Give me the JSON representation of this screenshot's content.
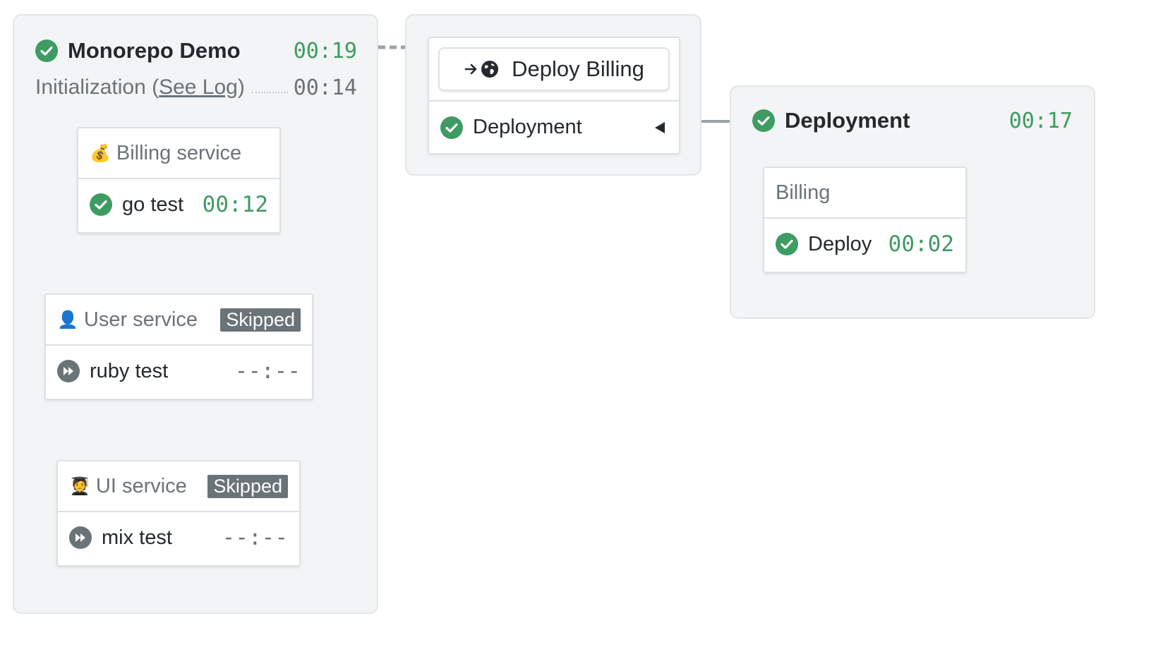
{
  "pipeline": {
    "title": "Monorepo Demo",
    "time": "00:19",
    "init_label": "Initialization (",
    "see_log": "See Log",
    "init_close": ")",
    "init_time": "00:14"
  },
  "groups": [
    {
      "emoji": "💰",
      "name": "Billing service",
      "badge": "",
      "job": "go test",
      "time": "00:12",
      "status": "passed"
    },
    {
      "emoji": "👤",
      "name": "User service",
      "badge": "Skipped",
      "job": "ruby test",
      "time": "--:--",
      "status": "skipped"
    },
    {
      "emoji": "🧑‍🎓",
      "name": "UI service",
      "badge": "Skipped",
      "job": "mix test",
      "time": "--:--",
      "status": "skipped"
    }
  ],
  "deploy_trigger": {
    "button_label": "Deploy Billing",
    "row_label": "Deployment"
  },
  "deployment": {
    "title": "Deployment",
    "time": "00:17",
    "card_title": "Billing",
    "job": "Deploy",
    "job_time": "00:02"
  },
  "colors": {
    "passed": "#3e9b62",
    "skipped": "#6a7378",
    "panel": "#f2f4f5"
  }
}
